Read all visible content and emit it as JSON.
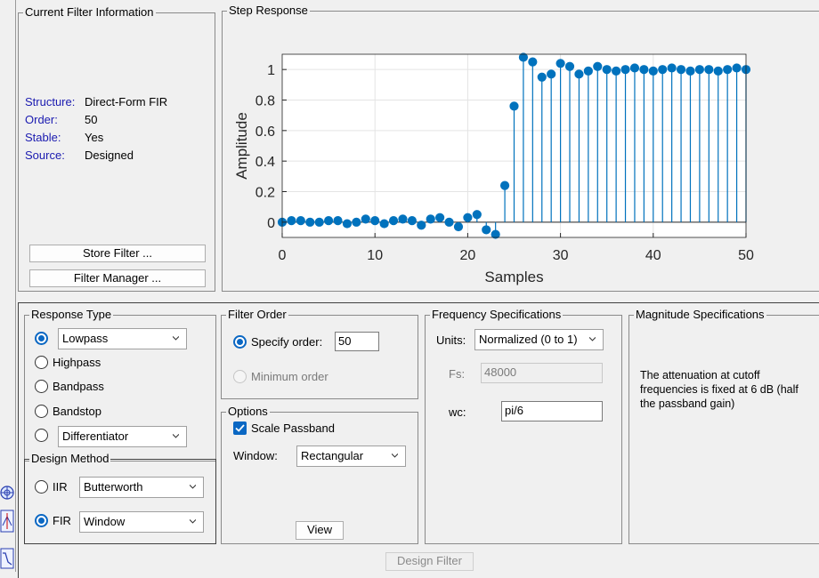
{
  "filter_info": {
    "title": "Current Filter Information",
    "rows": [
      {
        "key": "Structure:",
        "value": "Direct-Form FIR"
      },
      {
        "key": "Order:",
        "value": "50"
      },
      {
        "key": "Stable:",
        "value": "Yes"
      },
      {
        "key": "Source:",
        "value": "Designed"
      }
    ],
    "store_filter_button": "Store Filter ...",
    "filter_manager_button": "Filter Manager ..."
  },
  "step_response": {
    "title": "Step Response"
  },
  "response_type": {
    "title": "Response Type",
    "lowpass_select": "Lowpass",
    "highpass": "Highpass",
    "bandpass": "Bandpass",
    "bandstop": "Bandstop",
    "differentiator_select": "Differentiator",
    "selected": "Lowpass"
  },
  "design_method": {
    "title": "Design Method",
    "iir_label": "IIR",
    "iir_select": "Butterworth",
    "fir_label": "FIR",
    "fir_select": "Window",
    "selected": "FIR"
  },
  "filter_order": {
    "title": "Filter Order",
    "specify_label": "Specify order:",
    "order_value": "50",
    "minimum_label": "Minimum order"
  },
  "options": {
    "title": "Options",
    "scale_passband_label": "Scale Passband",
    "scale_passband_checked": true,
    "window_label": "Window:",
    "window_select": "Rectangular",
    "view_button": "View"
  },
  "freq_specs": {
    "title": "Frequency Specifications",
    "units_label": "Units:",
    "units_select": "Normalized (0 to 1)",
    "fs_label": "Fs:",
    "fs_value": "48000",
    "wc_label": "wc:",
    "wc_value": "pi/6"
  },
  "mag_specs": {
    "title": "Magnitude Specifications",
    "text": "The attenuation at cutoff frequencies is fixed at 6 dB (half the passband gain)"
  },
  "design_filter_button": "Design Filter",
  "chart_data": {
    "type": "stem",
    "xlabel": "Samples",
    "ylabel": "Amplitude",
    "xlim": [
      0,
      50
    ],
    "ylim": [
      -0.1,
      1.1
    ],
    "xticks": [
      0,
      10,
      20,
      30,
      40,
      50
    ],
    "yticks": [
      0,
      0.2,
      0.4,
      0.6,
      0.8,
      1
    ],
    "ytick_labels": [
      "0",
      "0.2",
      "0.4",
      "0.6",
      "0.8",
      "1"
    ],
    "grid": true,
    "color": "#0072bd",
    "x": [
      0,
      1,
      2,
      3,
      4,
      5,
      6,
      7,
      8,
      9,
      10,
      11,
      12,
      13,
      14,
      15,
      16,
      17,
      18,
      19,
      20,
      21,
      22,
      23,
      24,
      25,
      26,
      27,
      28,
      29,
      30,
      31,
      32,
      33,
      34,
      35,
      36,
      37,
      38,
      39,
      40,
      41,
      42,
      43,
      44,
      45,
      46,
      47,
      48,
      49,
      50
    ],
    "y": [
      0,
      0.01,
      0.01,
      0,
      0,
      0.01,
      0.01,
      -0.01,
      0,
      0.02,
      0.01,
      -0.01,
      0.01,
      0.02,
      0.01,
      -0.02,
      0.02,
      0.03,
      0,
      -0.03,
      0.03,
      0.05,
      -0.05,
      -0.08,
      0.24,
      0.76,
      1.08,
      1.05,
      0.95,
      0.97,
      1.04,
      1.02,
      0.97,
      0.99,
      1.02,
      1,
      0.99,
      1,
      1.01,
      1,
      0.99,
      1,
      1.01,
      1,
      0.99,
      1,
      1,
      0.99,
      1,
      1.01,
      1
    ]
  }
}
